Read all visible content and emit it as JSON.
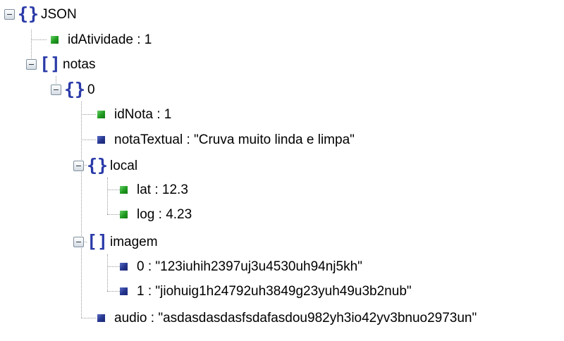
{
  "tree": {
    "root_label": "JSON",
    "id_atividade": "idAtividade : 1",
    "notas_label": "notas",
    "note_index": "0",
    "id_nota": "idNota : 1",
    "nota_textual": "notaTextual : \"Cruva muito linda e limpa\"",
    "local_label": "local",
    "lat": "lat : 12.3",
    "log": "log : 4.23",
    "imagem_label": "imagem",
    "imagem_0": "0 : \"123iuhih2397uj3u4530uh94nj5kh\"",
    "imagem_1": "1 : \"jiohuig1h24792uh3849g23yuh49u3b2nub\"",
    "audio": "audio : \"asdasdasdasfsdafasdou982yh3io42yv3bnuo2973un\""
  },
  "colors": {
    "number_leaf": "#1f9b1f",
    "string_leaf": "#25358f",
    "bracket": "#2a3aa8"
  },
  "icons": {
    "toggle": "collapse-minus-icon",
    "object": "curly-braces-icon",
    "array": "square-brackets-icon",
    "number": "green-square-icon",
    "string": "blue-square-icon"
  }
}
